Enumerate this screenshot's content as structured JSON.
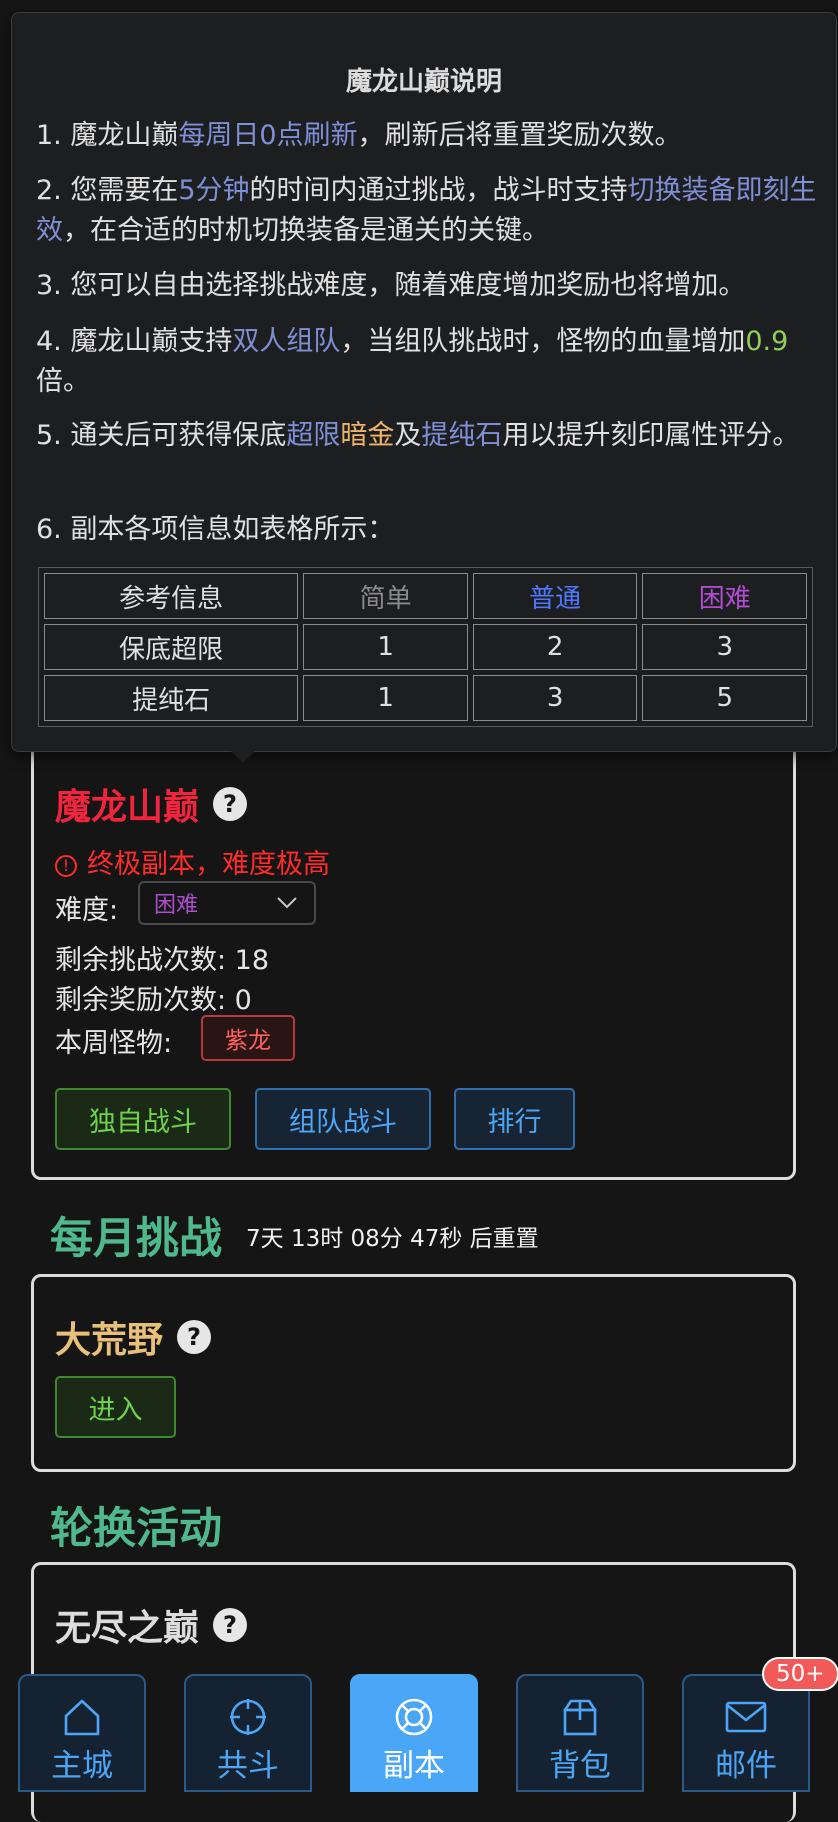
{
  "tooltip": {
    "title": "魔龙山巅说明",
    "p1": {
      "a": "1. 魔龙山巅",
      "b": "每周日0点刷新",
      "c": "，刷新后将重置奖励次数。"
    },
    "p2": {
      "a": "2. 您需要在",
      "b": "5分钟",
      "c": "的时间内通过挑战，战斗时支持",
      "d": "切换装备即刻生效",
      "e": "，在合适的时机切换装备是通关的关键。"
    },
    "p3": "3. 您可以自由选择挑战难度，随着难度增加奖励也将增加。",
    "p4": {
      "a": "4. 魔龙山巅支持",
      "b": "双人组队",
      "c": "，当组队挑战时，怪物的血量增加",
      "d": "0.9",
      "e": "倍。"
    },
    "p5": {
      "a": "5. 通关后可获得保底",
      "b": "超限",
      "c": "暗金",
      "d": "及",
      "e": "提纯石",
      "f": "用以提升刻印属性评分。"
    },
    "p6": "6. 副本各项信息如表格所示：",
    "table": {
      "headers": [
        "参考信息",
        "简单",
        "普通",
        "困难"
      ],
      "rows": [
        [
          "保底超限",
          "1",
          "2",
          "3"
        ],
        [
          "提纯石",
          "1",
          "3",
          "5"
        ]
      ]
    }
  },
  "molong": {
    "title": "魔龙山巅",
    "warning": "终极副本，难度极高",
    "difficulty_label": "难度:",
    "difficulty_value": "困难",
    "challenges_left": "剩余挑战次数: 18",
    "rewards_left": "剩余奖励次数: 0",
    "monster_label": "本周怪物:",
    "monster": "紫龙",
    "btn_solo": "独自战斗",
    "btn_team": "组队战斗",
    "btn_rank": "排行"
  },
  "monthly": {
    "title": "每月挑战",
    "reset": "7天 13时 08分 47秒 后重置",
    "card_title": "大荒野",
    "btn_enter": "进入"
  },
  "rotation": {
    "title": "轮换活动",
    "card_title": "无尽之巅"
  },
  "nav": {
    "items": [
      {
        "label": "主城",
        "icon": "home-icon"
      },
      {
        "label": "共斗",
        "icon": "crosshair-icon"
      },
      {
        "label": "副本",
        "icon": "lifebuoy-icon",
        "active": true
      },
      {
        "label": "背包",
        "icon": "box-icon"
      },
      {
        "label": "邮件",
        "icon": "mail-icon"
      }
    ],
    "mail_badge": "50+"
  },
  "colors": {
    "danger_title": "#f0243c",
    "gold_title": "#e8c07a",
    "gray_title": "#dcdcdc",
    "section_green": "#4fb88c",
    "accent_blue": "#4aa6f6"
  }
}
